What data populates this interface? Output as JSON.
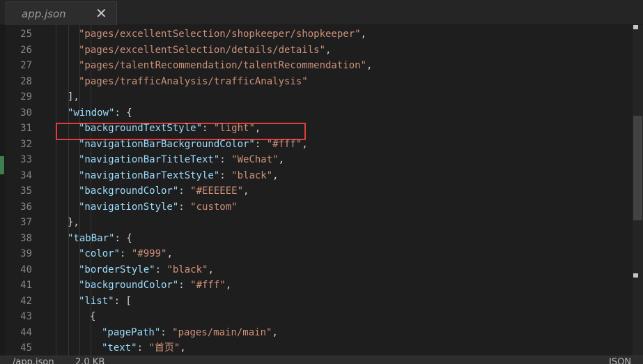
{
  "tab": {
    "title": "app.json",
    "close": "✕"
  },
  "editor": {
    "lines": [
      {
        "n": "25",
        "tokens": [
          {
            "c": "s",
            "t": "\"pages/excellentSelection/shopkeeper/shopkeeper\""
          },
          {
            "c": "p",
            "t": ","
          }
        ]
      },
      {
        "n": "26",
        "tokens": [
          {
            "c": "s",
            "t": "\"pages/excellentSelection/details/details\""
          },
          {
            "c": "p",
            "t": ","
          }
        ]
      },
      {
        "n": "27",
        "tokens": [
          {
            "c": "s",
            "t": "\"pages/talentRecommendation/talentRecommendation\""
          },
          {
            "c": "p",
            "t": ","
          }
        ]
      },
      {
        "n": "28",
        "tokens": [
          {
            "c": "s",
            "t": "\"pages/trafficAnalysis/trafficAnalysis\""
          }
        ]
      },
      {
        "n": "29",
        "tokens": [
          {
            "c": "p",
            "t": "],"
          }
        ]
      },
      {
        "n": "30",
        "tokens": [
          {
            "c": "k",
            "t": "\"window\""
          },
          {
            "c": "p",
            "t": ": {"
          }
        ]
      },
      {
        "n": "31",
        "tokens": [
          {
            "c": "k",
            "t": "\"backgroundTextStyle\""
          },
          {
            "c": "p",
            "t": ": "
          },
          {
            "c": "s",
            "t": "\"light\""
          },
          {
            "c": "p",
            "t": ","
          }
        ]
      },
      {
        "n": "32",
        "tokens": [
          {
            "c": "k",
            "t": "\"navigationBarBackgroundColor\""
          },
          {
            "c": "p",
            "t": ": "
          },
          {
            "c": "s",
            "t": "\"#fff\""
          },
          {
            "c": "p",
            "t": ","
          }
        ]
      },
      {
        "n": "33",
        "tokens": [
          {
            "c": "k",
            "t": "\"navigationBarTitleText\""
          },
          {
            "c": "p",
            "t": ": "
          },
          {
            "c": "s",
            "t": "\"WeChat\""
          },
          {
            "c": "p",
            "t": ","
          }
        ]
      },
      {
        "n": "34",
        "tokens": [
          {
            "c": "k",
            "t": "\"navigationBarTextStyle\""
          },
          {
            "c": "p",
            "t": ": "
          },
          {
            "c": "s",
            "t": "\"black\""
          },
          {
            "c": "p",
            "t": ","
          }
        ]
      },
      {
        "n": "35",
        "tokens": [
          {
            "c": "k",
            "t": "\"backgroundColor\""
          },
          {
            "c": "p",
            "t": ": "
          },
          {
            "c": "s",
            "t": "\"#EEEEEE\""
          },
          {
            "c": "p",
            "t": ","
          }
        ]
      },
      {
        "n": "36",
        "tokens": [
          {
            "c": "k",
            "t": "\"navigationStyle\""
          },
          {
            "c": "p",
            "t": ": "
          },
          {
            "c": "s",
            "t": "\"custom\""
          }
        ]
      },
      {
        "n": "37",
        "tokens": [
          {
            "c": "p",
            "t": "},"
          }
        ]
      },
      {
        "n": "38",
        "tokens": [
          {
            "c": "k",
            "t": "\"tabBar\""
          },
          {
            "c": "p",
            "t": ": {"
          }
        ]
      },
      {
        "n": "39",
        "tokens": [
          {
            "c": "k",
            "t": "\"color\""
          },
          {
            "c": "p",
            "t": ": "
          },
          {
            "c": "s",
            "t": "\"#999\""
          },
          {
            "c": "p",
            "t": ","
          }
        ]
      },
      {
        "n": "40",
        "tokens": [
          {
            "c": "k",
            "t": "\"borderStyle\""
          },
          {
            "c": "p",
            "t": ": "
          },
          {
            "c": "s",
            "t": "\"black\""
          },
          {
            "c": "p",
            "t": ","
          }
        ]
      },
      {
        "n": "41",
        "tokens": [
          {
            "c": "k",
            "t": "\"backgroundColor\""
          },
          {
            "c": "p",
            "t": ": "
          },
          {
            "c": "s",
            "t": "\"#fff\""
          },
          {
            "c": "p",
            "t": ","
          }
        ]
      },
      {
        "n": "42",
        "tokens": [
          {
            "c": "k",
            "t": "\"list\""
          },
          {
            "c": "p",
            "t": ": ["
          }
        ]
      },
      {
        "n": "43",
        "tokens": [
          {
            "c": "p",
            "t": "{"
          }
        ]
      },
      {
        "n": "44",
        "tokens": [
          {
            "c": "k",
            "t": "\"pagePath\""
          },
          {
            "c": "p",
            "t": ": "
          },
          {
            "c": "s",
            "t": "\"pages/main/main\""
          },
          {
            "c": "p",
            "t": ","
          }
        ]
      },
      {
        "n": "45",
        "tokens": [
          {
            "c": "k",
            "t": "\"text\""
          },
          {
            "c": "p",
            "t": ": "
          },
          {
            "c": "s",
            "t": "\"首页\""
          },
          {
            "c": "p",
            "t": ","
          }
        ]
      }
    ]
  },
  "status": {
    "file": "/app.json",
    "size": "2.0 KB",
    "mode": "JSON"
  },
  "colors": {
    "background": "#1e1e1e",
    "string": "#ce9178",
    "key": "#9cdcfe",
    "highlight": "#e03c3c"
  }
}
